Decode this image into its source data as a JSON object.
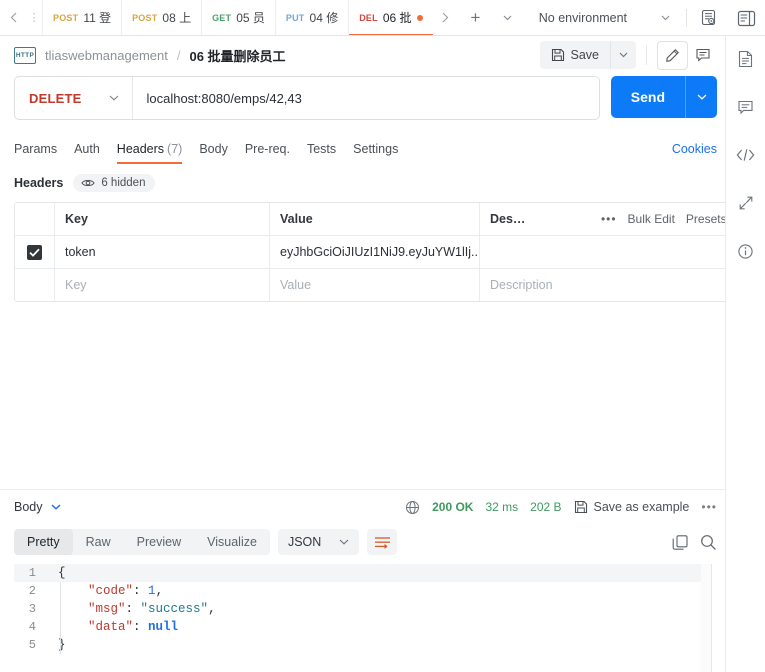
{
  "tabstrip": {
    "nav_back": "‹",
    "nav_forward": "›",
    "overflow_left": "⋮",
    "plus": "+",
    "caret": "⌄",
    "tabs": [
      {
        "method": "POST",
        "label": "11 登",
        "method_class": "m-post",
        "active": false,
        "dirty": false
      },
      {
        "method": "POST",
        "label": "08 上",
        "method_class": "m-post",
        "active": false,
        "dirty": false
      },
      {
        "method": "GET",
        "label": "05 员",
        "method_class": "m-get",
        "active": false,
        "dirty": false
      },
      {
        "method": "PUT",
        "label": "04 修",
        "method_class": "m-put",
        "active": false,
        "dirty": false
      },
      {
        "method": "DEL",
        "label": "06 批",
        "method_class": "m-del",
        "active": true,
        "dirty": true
      }
    ],
    "environment": "No environment"
  },
  "breadcrumb": {
    "protocol_badge": "HTTP",
    "collection": "tliaswebmanagement",
    "separator": "/",
    "current": "06 批量删除员工",
    "save_label": "Save",
    "save_caret": "⌄"
  },
  "url": {
    "method": "DELETE",
    "method_caret": "⌄",
    "value": "localhost:8080/emps/42,43",
    "send_label": "Send",
    "send_caret": "⌄"
  },
  "request_tabs": {
    "items": [
      {
        "label": "Params",
        "count": "",
        "active": false
      },
      {
        "label": "Auth",
        "count": "",
        "active": false
      },
      {
        "label": "Headers",
        "count": "(7)",
        "active": true
      },
      {
        "label": "Body",
        "count": "",
        "active": false
      },
      {
        "label": "Pre-req.",
        "count": "",
        "active": false
      },
      {
        "label": "Tests",
        "count": "",
        "active": false
      },
      {
        "label": "Settings",
        "count": "",
        "active": false
      }
    ],
    "cookies": "Cookies"
  },
  "headers_section": {
    "title": "Headers",
    "hidden_label": "6 hidden",
    "columns": {
      "key": "Key",
      "value": "Value",
      "description": "Des…"
    },
    "actions": {
      "more": "•••",
      "bulk_edit": "Bulk Edit",
      "presets": "Presets",
      "presets_caret": "⌄"
    },
    "rows": [
      {
        "checked": true,
        "key": "token",
        "value": "eyJhbGciOiJIUzI1NiJ9.eyJuYW1lIj...",
        "description": ""
      }
    ],
    "placeholder_row": {
      "key": "Key",
      "value": "Value",
      "description": "Description"
    }
  },
  "response": {
    "body_label": "Body",
    "body_caret": "⌄",
    "status": "200 OK",
    "time": "32 ms",
    "size": "202 B",
    "save_as_example": "Save as example",
    "more": "•••",
    "view_tabs": [
      {
        "label": "Pretty",
        "active": true
      },
      {
        "label": "Raw",
        "active": false
      },
      {
        "label": "Preview",
        "active": false
      },
      {
        "label": "Visualize",
        "active": false
      }
    ],
    "format": "JSON",
    "format_caret": "⌄",
    "code_lines": [
      {
        "n": "1",
        "segments": [
          {
            "t": "{",
            "c": ""
          }
        ]
      },
      {
        "n": "2",
        "segments": [
          {
            "t": "    ",
            "c": ""
          },
          {
            "t": "\"code\"",
            "c": "tok-key"
          },
          {
            "t": ": ",
            "c": ""
          },
          {
            "t": "1",
            "c": "tok-num"
          },
          {
            "t": ",",
            "c": ""
          }
        ]
      },
      {
        "n": "3",
        "segments": [
          {
            "t": "    ",
            "c": ""
          },
          {
            "t": "\"msg\"",
            "c": "tok-key"
          },
          {
            "t": ": ",
            "c": ""
          },
          {
            "t": "\"success\"",
            "c": "tok-str"
          },
          {
            "t": ",",
            "c": ""
          }
        ]
      },
      {
        "n": "4",
        "segments": [
          {
            "t": "    ",
            "c": ""
          },
          {
            "t": "\"data\"",
            "c": "tok-key"
          },
          {
            "t": ": ",
            "c": ""
          },
          {
            "t": "null",
            "c": "tok-null"
          }
        ]
      },
      {
        "n": "5",
        "segments": [
          {
            "t": "}",
            "c": ""
          }
        ]
      }
    ]
  },
  "colors": {
    "accent_orange": "#f26b3a",
    "send_blue": "#0d7bf7",
    "link_blue": "#1f6feb",
    "status_green": "#3e9b5f",
    "method_delete": "#c0392b"
  }
}
